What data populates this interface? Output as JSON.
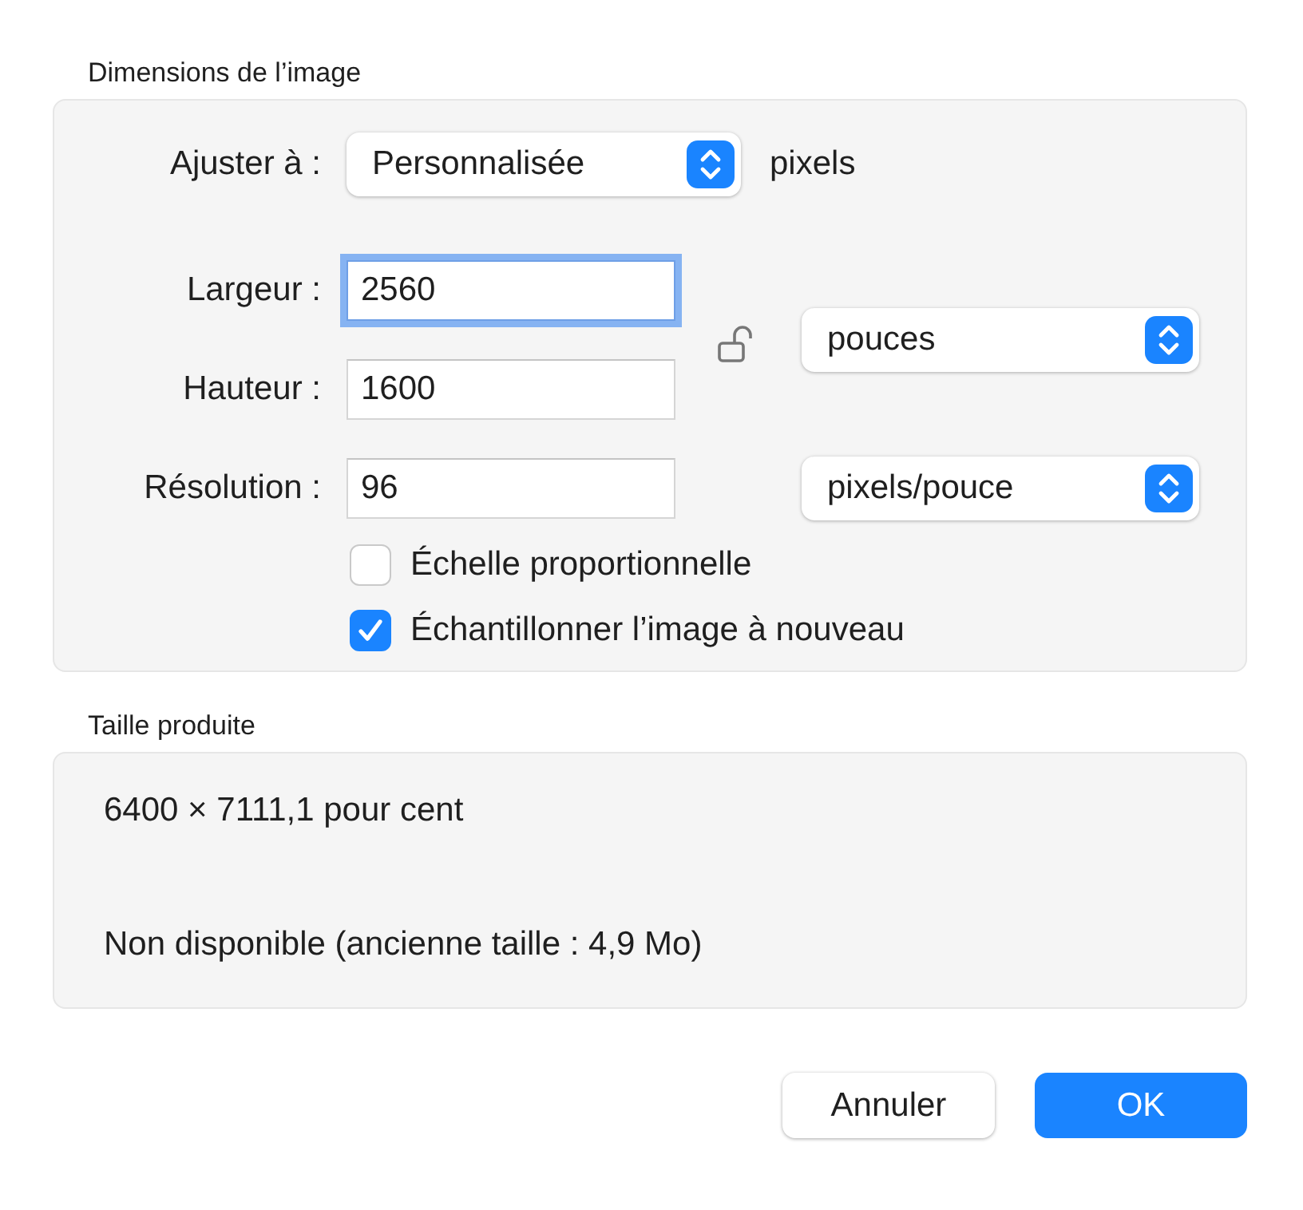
{
  "image_dimensions": {
    "title": "Dimensions de l’image",
    "fit": {
      "label": "Ajuster à :",
      "value": "Personnalisée",
      "unit": "pixels"
    },
    "fields": [
      {
        "label": "Largeur :",
        "value": "2560",
        "focused": true
      },
      {
        "label": "Hauteur :",
        "value": "1600",
        "focused": false
      },
      {
        "label": "Résolution :",
        "value": "96",
        "focused": false
      }
    ],
    "proportion_lock": {
      "locked": false
    },
    "size_unit": "pouces",
    "resolution_unit": "pixels/pouce",
    "checkboxes": [
      {
        "label": "Échelle proportionnelle",
        "checked": false
      },
      {
        "label": "Échantillonner l’image à nouveau",
        "checked": true
      }
    ]
  },
  "output_size": {
    "title": "Taille produite",
    "lines": [
      "6400 × 7111,1 pour cent",
      "Non disponible (ancienne taille : 4,9 Mo)"
    ]
  },
  "buttons": [
    {
      "label": "Annuler",
      "default": false
    },
    {
      "label": "OK",
      "default": true
    }
  ]
}
